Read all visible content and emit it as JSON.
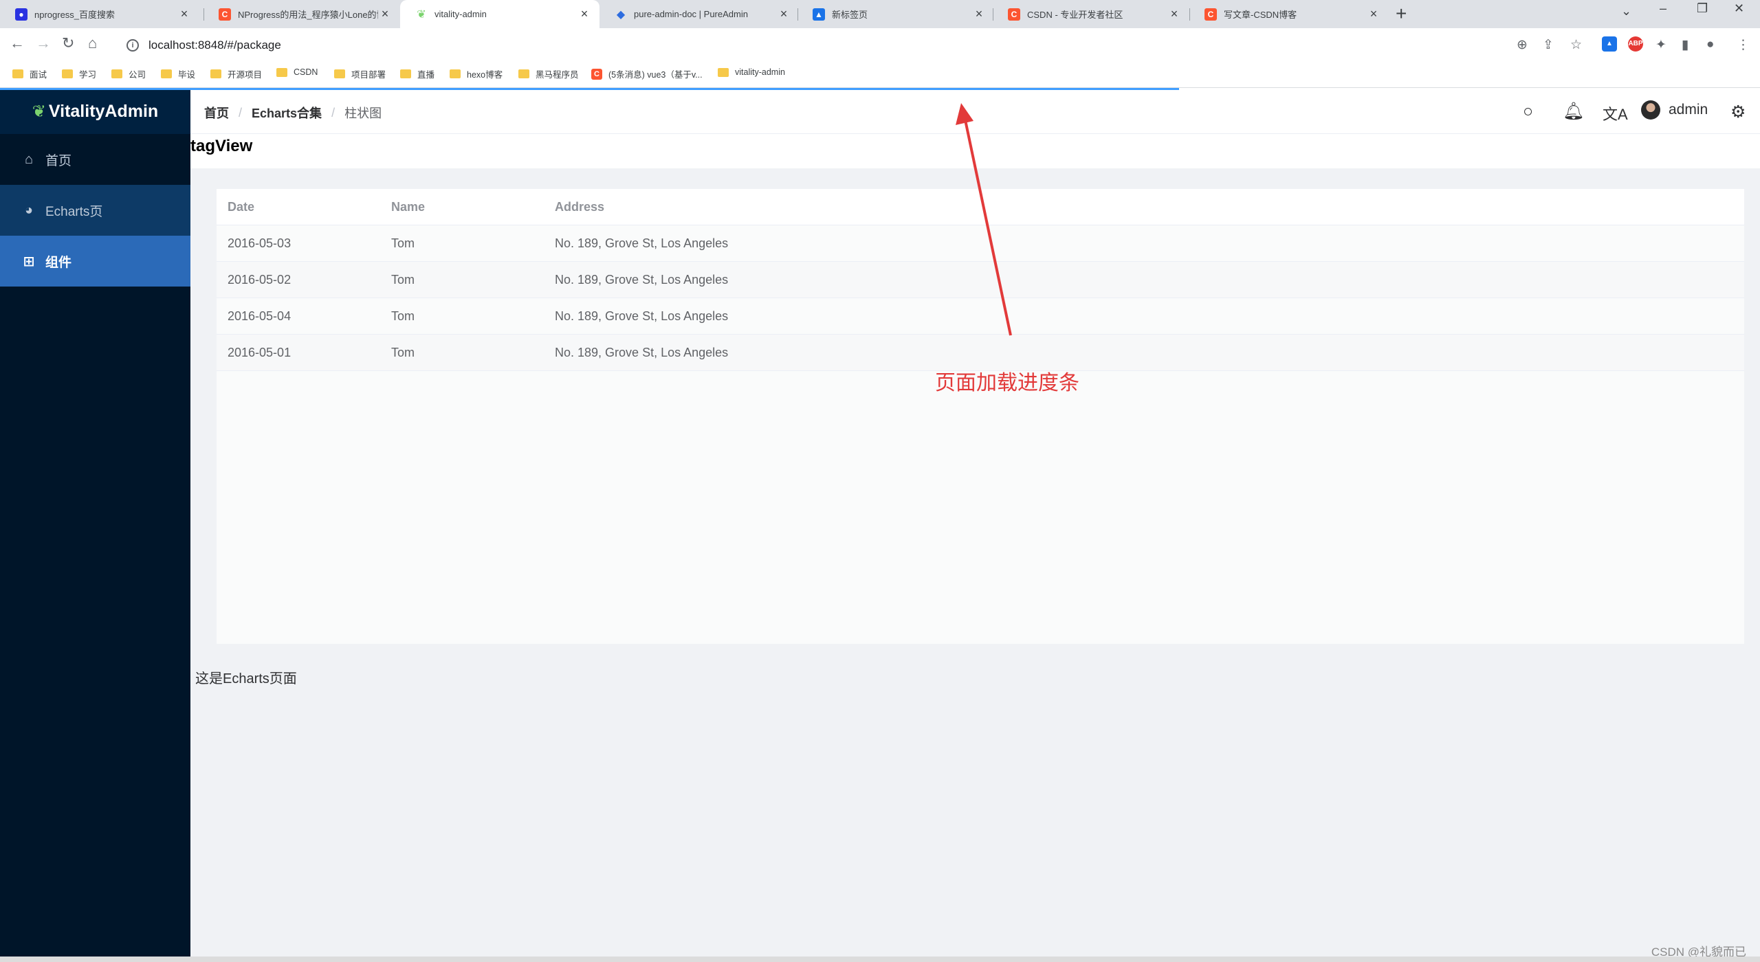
{
  "browser": {
    "tabs": [
      {
        "title": "nprogress_百度搜索",
        "favicon": "baidu-paw-icon",
        "active": false
      },
      {
        "title": "NProgress的用法_程序猿小Lone的博客",
        "favicon": "csdn-icon",
        "active": false
      },
      {
        "title": "vitality-admin",
        "favicon": "leaf-icon",
        "active": true
      },
      {
        "title": "pure-admin-doc | PureAdmin",
        "favicon": "drop-icon",
        "active": false
      },
      {
        "title": "新标签页",
        "favicon": "newtab-icon",
        "active": false
      },
      {
        "title": "CSDN - 专业开发者社区",
        "favicon": "csdn-icon",
        "active": false
      },
      {
        "title": "写文章-CSDN博客",
        "favicon": "csdn-icon",
        "active": false
      }
    ],
    "url": "localhost:8848/#/package",
    "bookmarks": [
      "面试",
      "学习",
      "公司",
      "毕设",
      "开源项目",
      "CSDN",
      "项目部署",
      "直播",
      "hexo博客",
      "黑马程序员",
      "(5条消息) vue3（基于v...",
      "vitality-admin"
    ]
  },
  "app": {
    "logo": "VitalityAdmin",
    "menu": [
      {
        "label": "首页",
        "icon": "home-icon"
      },
      {
        "label": "Echarts页",
        "icon": "pie-chart-icon"
      },
      {
        "label": "组件",
        "icon": "grid-icon"
      }
    ],
    "breadcrumb": [
      "首页",
      "Echarts合集",
      "柱状图"
    ],
    "user": "admin",
    "tagview_title": "tagView",
    "progress_fraction": 0.67,
    "table": {
      "headers": [
        "Date",
        "Name",
        "Address"
      ],
      "rows": [
        [
          "2016-05-03",
          "Tom",
          "No. 189, Grove St, Los Angeles"
        ],
        [
          "2016-05-02",
          "Tom",
          "No. 189, Grove St, Los Angeles"
        ],
        [
          "2016-05-04",
          "Tom",
          "No. 189, Grove St, Los Angeles"
        ],
        [
          "2016-05-01",
          "Tom",
          "No. 189, Grove St, Los Angeles"
        ]
      ]
    },
    "page_text": "这是Echarts页面"
  },
  "annotation": {
    "text": "页面加载进度条",
    "color": "#e23a3a"
  },
  "watermark": "CSDN @礼貌而已",
  "colors": {
    "sidebar": "#001529",
    "menu_active": "#2b6ab8",
    "progress": "#409eff"
  }
}
